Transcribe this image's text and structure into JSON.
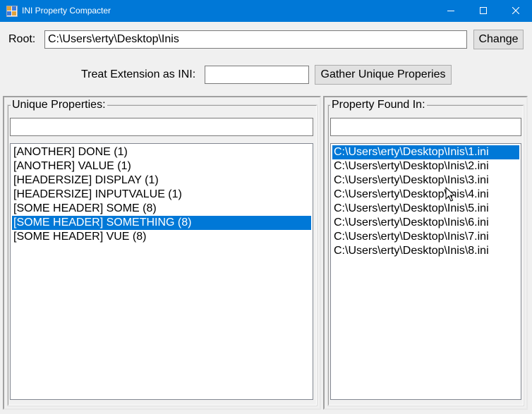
{
  "window": {
    "title": "INI Property Compacter"
  },
  "root": {
    "label": "Root:",
    "value": "C:\\Users\\erty\\Desktop\\Inis",
    "change_label": "Change"
  },
  "extension": {
    "label": "Treat Extension as INI:",
    "value": "",
    "gather_label": "Gather Unique Properies"
  },
  "unique_properties": {
    "title": "Unique Properties:",
    "filter_value": "",
    "selected_index": 5,
    "items": [
      "[ANOTHER] DONE (1)",
      "[ANOTHER] VALUE (1)",
      "[HEADERSIZE] DISPLAY (1)",
      "[HEADERSIZE] INPUTVALUE (1)",
      "[SOME HEADER] SOME (8)",
      "[SOME HEADER] SOMETHING (8)",
      "[SOME HEADER] VUE (8)"
    ]
  },
  "found_in": {
    "title": "Property Found In:",
    "filter_value": "",
    "selected_index": 0,
    "items": [
      "C:\\Users\\erty\\Desktop\\Inis\\1.ini",
      "C:\\Users\\erty\\Desktop\\Inis\\2.ini",
      "C:\\Users\\erty\\Desktop\\Inis\\3.ini",
      "C:\\Users\\erty\\Desktop\\Inis\\4.ini",
      "C:\\Users\\erty\\Desktop\\Inis\\5.ini",
      "C:\\Users\\erty\\Desktop\\Inis\\6.ini",
      "C:\\Users\\erty\\Desktop\\Inis\\7.ini",
      "C:\\Users\\erty\\Desktop\\Inis\\8.ini"
    ]
  },
  "icons": {
    "app": "app-icon",
    "minimize": "minimize-icon",
    "maximize": "maximize-icon",
    "close": "close-icon",
    "cursor": "mouse-cursor-icon"
  },
  "colors": {
    "titlebar": "#0078d7",
    "selection": "#0078d7",
    "background": "#f0f0f0"
  }
}
